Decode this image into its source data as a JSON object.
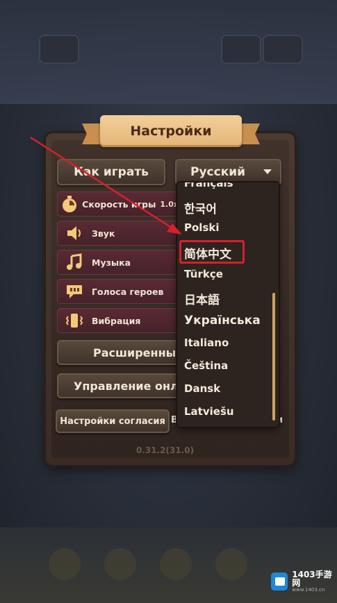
{
  "header": {
    "title": "Настройки"
  },
  "top_buttons": {
    "how_to_play": "Как играть",
    "language_selected": "Русский"
  },
  "settings_rows": [
    {
      "label": "Скорость игры",
      "value": "1.0x",
      "icon": "stopwatch-icon"
    },
    {
      "label": "Звук",
      "icon": "speaker-icon"
    },
    {
      "label": "Музыка",
      "icon": "music-note-icon"
    },
    {
      "label": "Голоса героев",
      "icon": "speech-bubble-icon"
    },
    {
      "label": "Вибрация",
      "icon": "vibration-icon"
    }
  ],
  "buttons": {
    "advanced": "Расширенные",
    "manage_online": "Управление онла",
    "consent": "Настройки согласия",
    "consent_right_partial": "В",
    "consent_right_end": "и"
  },
  "version": "0.31.2(31.0)",
  "language_options": [
    "Français",
    "한국어",
    "Polski",
    "简体中文",
    "Türkçe",
    "日本語",
    "Українська",
    "Italiano",
    "Čeština",
    "Dansk",
    "Latviešu"
  ],
  "highlighted_option": "简体中文",
  "watermark": {
    "text": "1403手游网",
    "sub": "www.1403.cn"
  },
  "colors": {
    "ribbon": "#e2b577",
    "row_bg": "#5a2a33",
    "highlight": "#d8202a",
    "arrow": "#d8202a"
  }
}
